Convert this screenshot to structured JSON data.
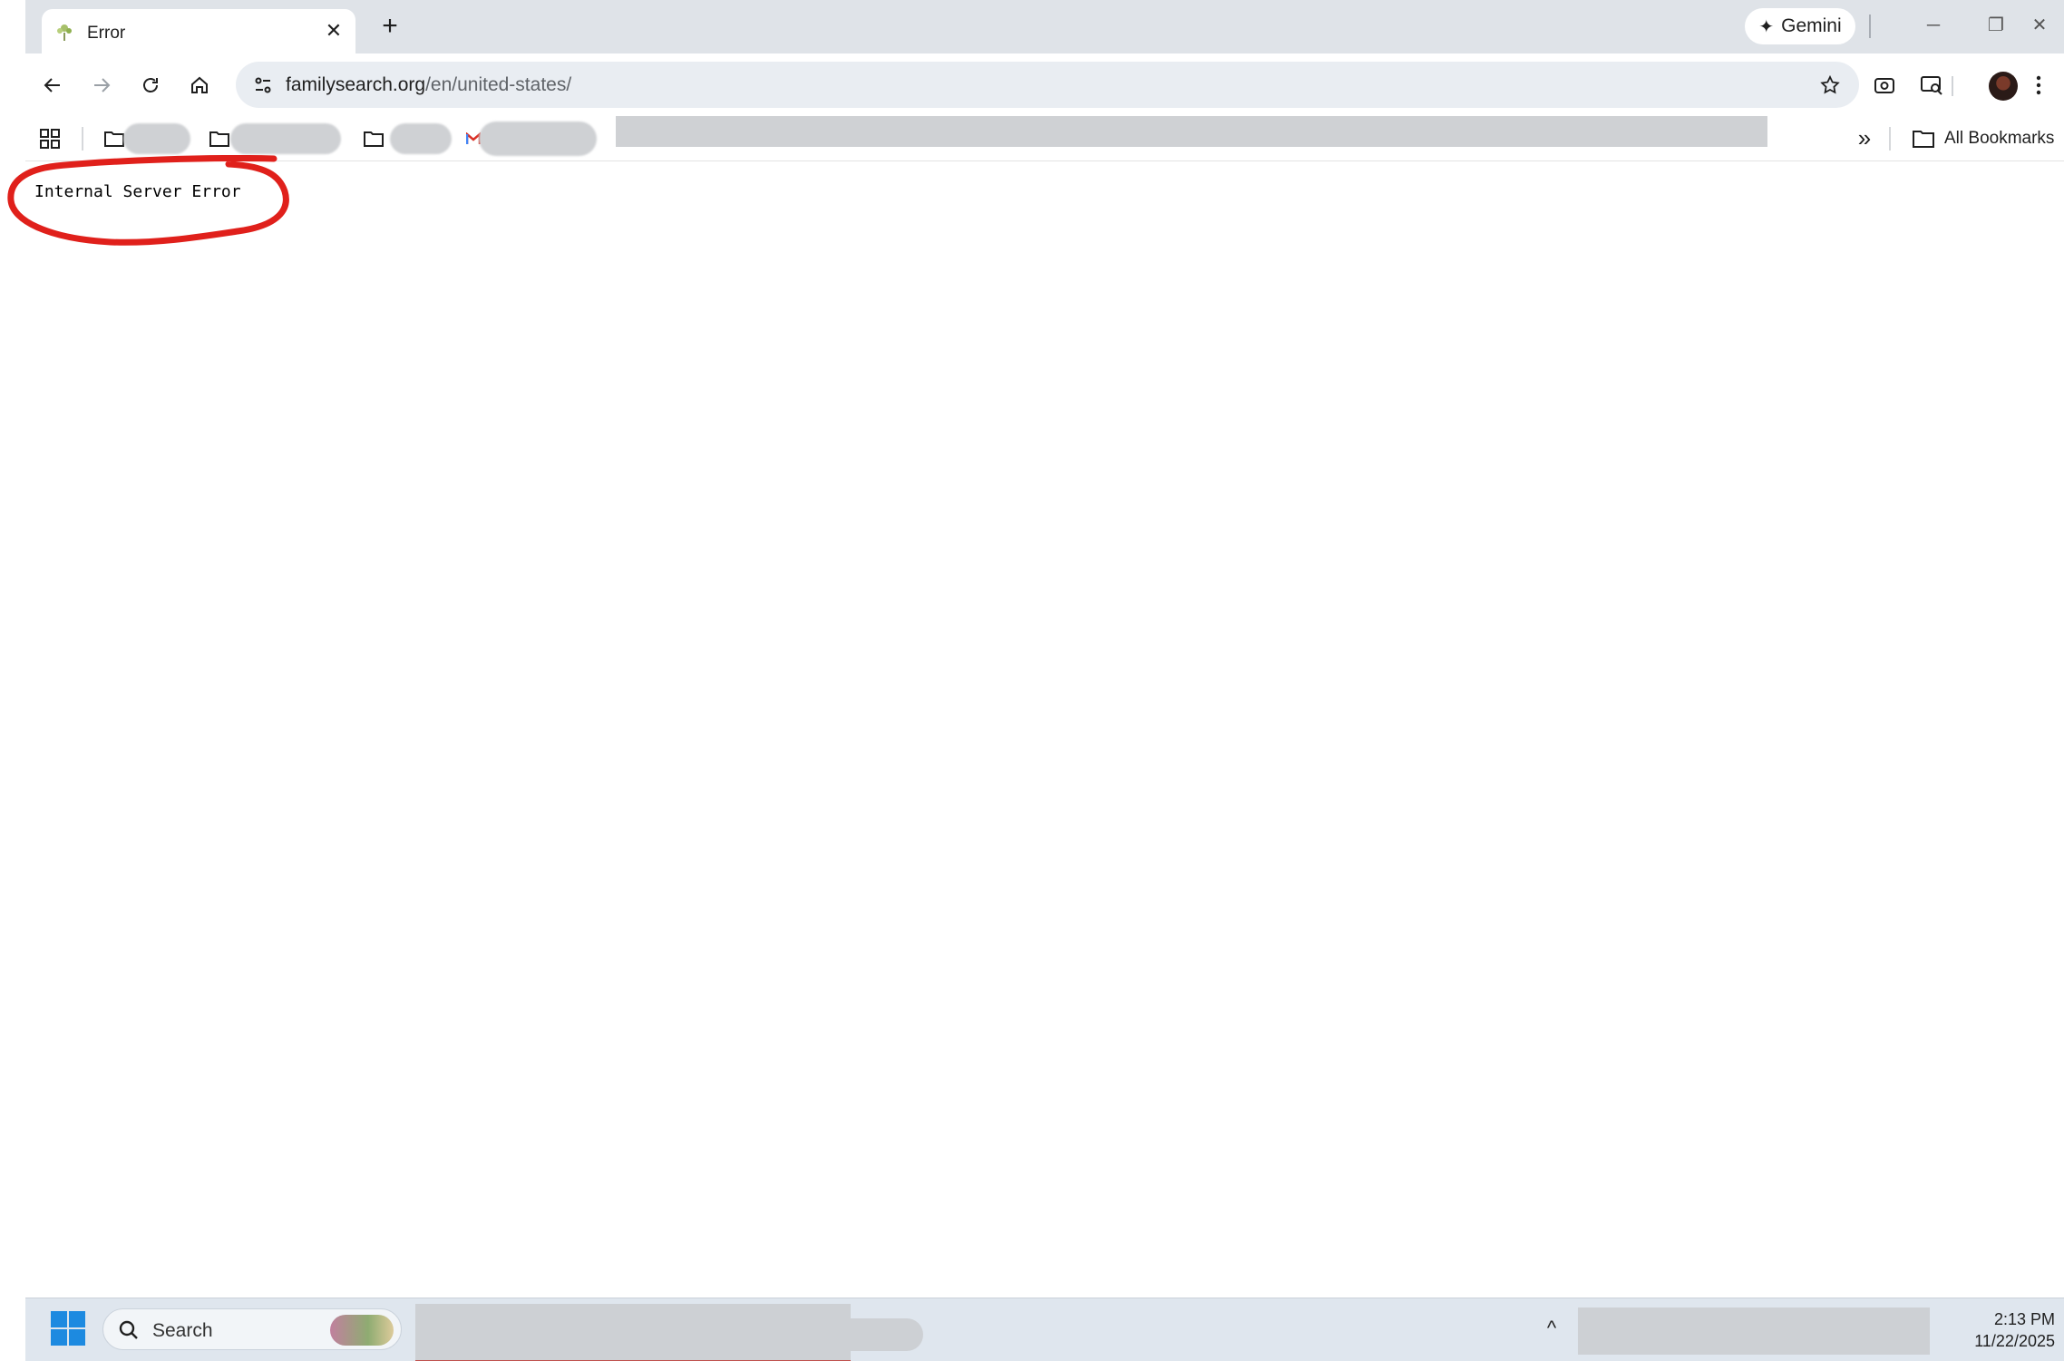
{
  "browser": {
    "tab": {
      "title": "Error",
      "favicon": "familysearch-tree-icon"
    },
    "new_tab_label": "+",
    "gemini_label": "Gemini",
    "window_controls": {
      "minimize": "─",
      "restore": "❐",
      "close": "✕"
    },
    "url_host": "familysearch.org",
    "url_path": "/en/united-states/",
    "bookmarks_overflow": "»",
    "all_bookmarks_label": "All Bookmarks"
  },
  "page": {
    "error_message": "Internal Server Error",
    "annotation_color": "#e0201b"
  },
  "taskbar": {
    "search_placeholder": "Search",
    "tray_chevron": "^",
    "time": "2:13 PM",
    "date": "11/22/2025"
  }
}
